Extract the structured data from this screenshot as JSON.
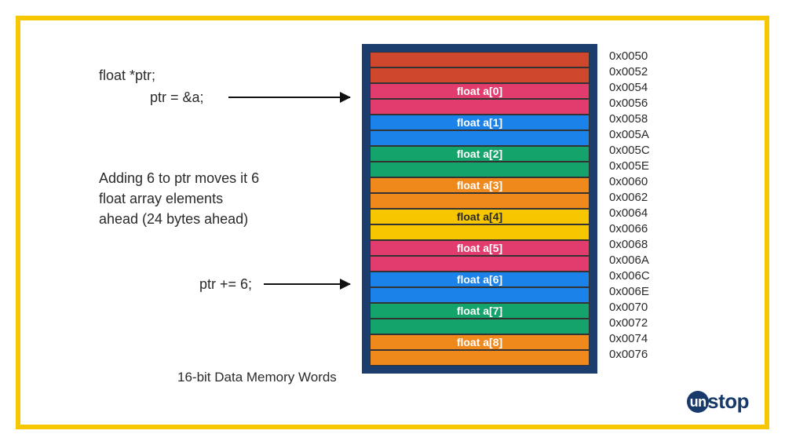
{
  "declaration": "float *ptr;",
  "assign_ptr": "ptr = &a;",
  "explain_line1": "Adding 6 to ptr moves it 6",
  "explain_line2": "float array elements",
  "explain_line3": "ahead (24 bytes ahead)",
  "increment_ptr": "ptr += 6;",
  "caption": "16-bit Data Memory Words",
  "logo_prefix": "un",
  "logo_rest": "stop",
  "colors": {
    "red": "#cf472c",
    "pink": "#e23b6d",
    "blue": "#1a82e8",
    "green": "#14a36a",
    "orange": "#f0891b",
    "yellow": "#f6c600"
  },
  "rows": [
    {
      "color": "red",
      "label": ""
    },
    {
      "color": "red",
      "label": ""
    },
    {
      "color": "pink",
      "label": "float a[0]"
    },
    {
      "color": "pink",
      "label": ""
    },
    {
      "color": "blue",
      "label": "float a[1]"
    },
    {
      "color": "blue",
      "label": ""
    },
    {
      "color": "green",
      "label": "float a[2]"
    },
    {
      "color": "green",
      "label": ""
    },
    {
      "color": "orange",
      "label": "float a[3]"
    },
    {
      "color": "orange",
      "label": ""
    },
    {
      "color": "yellow",
      "label": "float a[4]",
      "text_dark": true
    },
    {
      "color": "yellow",
      "label": "",
      "text_dark": true
    },
    {
      "color": "pink",
      "label": "float a[5]"
    },
    {
      "color": "pink",
      "label": ""
    },
    {
      "color": "blue",
      "label": "float a[6]"
    },
    {
      "color": "blue",
      "label": ""
    },
    {
      "color": "green",
      "label": "float a[7]"
    },
    {
      "color": "green",
      "label": ""
    },
    {
      "color": "orange",
      "label": "float a[8]"
    },
    {
      "color": "orange",
      "label": ""
    }
  ],
  "addresses": [
    "0x0050",
    "0x0052",
    "0x0054",
    "0x0056",
    "0x0058",
    "0x005A",
    "0x005C",
    "0x005E",
    "0x0060",
    "0x0062",
    "0x0064",
    "0x0066",
    "0x0068",
    "0x006A",
    "0x006C",
    "0x006E",
    "0x0070",
    "0x0072",
    "0x0074",
    "0x0076"
  ]
}
